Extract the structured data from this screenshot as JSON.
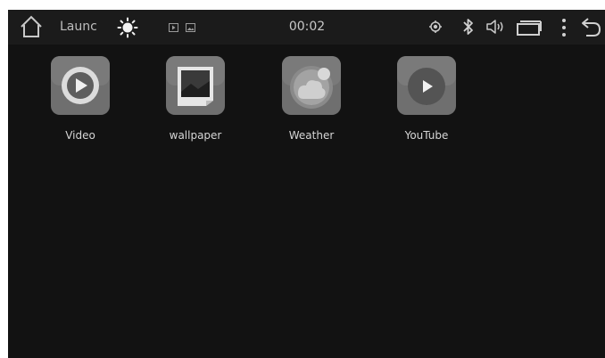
{
  "status_bar": {
    "app_title": "Launc",
    "clock": "00:02",
    "icons": [
      "home-icon",
      "sun-icon",
      "media-play-icon",
      "image-icon",
      "gps-icon",
      "bluetooth-icon",
      "volume-icon",
      "window-icon",
      "menu-icon",
      "back-icon"
    ]
  },
  "apps": [
    {
      "label": "Video",
      "icon": "video-play-icon"
    },
    {
      "label": "wallpaper",
      "icon": "wallpaper-icon"
    },
    {
      "label": "Weather",
      "icon": "weather-icon"
    },
    {
      "label": "YouTube",
      "icon": "youtube-play-icon"
    }
  ],
  "colors": {
    "background": "#121212",
    "status_bar": "#1b1b1b",
    "icon_tile": "#6e6e6e",
    "text": "#d6d6d6"
  }
}
